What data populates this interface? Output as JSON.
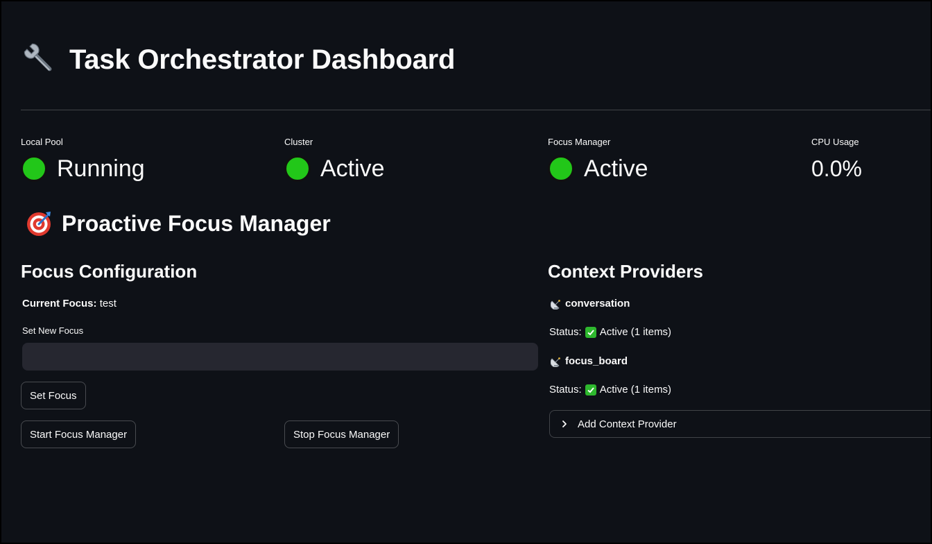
{
  "header": {
    "icon": "wrench-icon",
    "title": "Task Orchestrator Dashboard"
  },
  "metrics": [
    {
      "label": "Local Pool",
      "value": "Running",
      "indicator": "green-circle-icon"
    },
    {
      "label": "Cluster",
      "value": "Active",
      "indicator": "green-circle-icon"
    },
    {
      "label": "Focus Manager",
      "value": "Active",
      "indicator": "green-circle-icon"
    },
    {
      "label": "CPU Usage",
      "value": "0.0%"
    }
  ],
  "section": {
    "icon": "target-icon",
    "title": "Proactive Focus Manager"
  },
  "focus_config": {
    "title": "Focus Configuration",
    "current_focus_label": "Current Focus:",
    "current_focus_value": "test",
    "input_label": "Set New Focus",
    "input_value": "",
    "input_placeholder": "",
    "set_focus_button": "Set Focus",
    "start_button": "Start Focus Manager",
    "stop_button": "Stop Focus Manager"
  },
  "context_providers": {
    "title": "Context Providers",
    "items": [
      {
        "icon": "satellite-antenna-icon",
        "name": "conversation",
        "status_label": "Status:",
        "status_icon": "check-mark-icon",
        "status_text": "Active (1 items)"
      },
      {
        "icon": "satellite-antenna-icon",
        "name": "focus_board",
        "status_label": "Status:",
        "status_icon": "check-mark-icon",
        "status_text": "Active (1 items)"
      }
    ],
    "add_provider_label": "Add Context Provider"
  },
  "colors": {
    "background": "#0e1117",
    "status_green": "#22c719",
    "check_green": "#2eb82e",
    "input_bg": "#262730"
  }
}
